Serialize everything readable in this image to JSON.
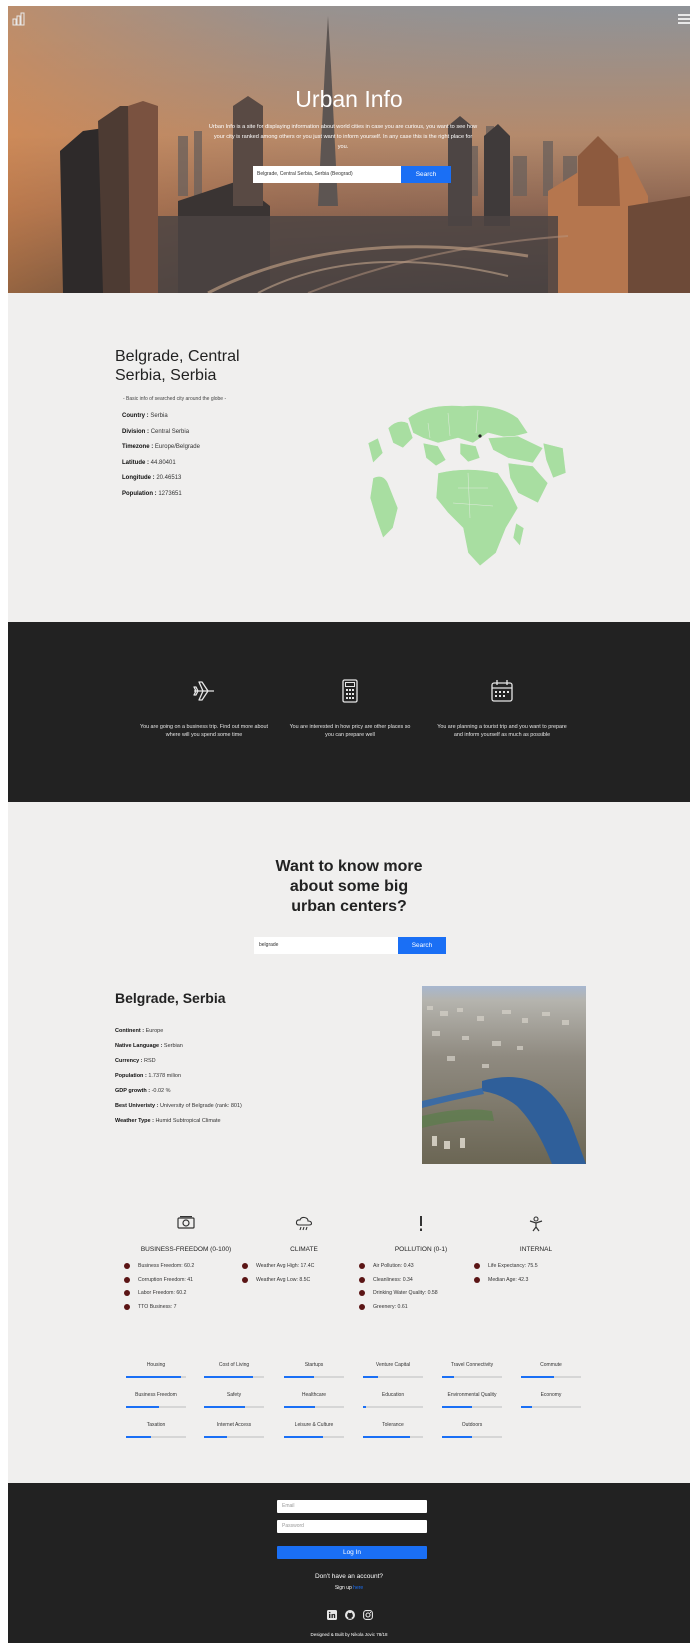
{
  "hero": {
    "title": "Urban Info",
    "tagline": "Urban Info is a site for displaying information about world cities in case you are curious, you want to see how your city is ranked among others or you just want to inform yourself. In any case this is the right place for you.",
    "search_value": "Belgrade, Central Serbia, Serbia (Beograd)",
    "search_button": "Search"
  },
  "city": {
    "title": "Belgrade, Central Serbia, Serbia",
    "subtitle": "- Basic info of searched city around the globe -",
    "fields": [
      {
        "label": "Country :",
        "value": "Serbia"
      },
      {
        "label": "Division :",
        "value": "Central Serbia"
      },
      {
        "label": "Timezone :",
        "value": "Europe/Belgrade"
      },
      {
        "label": "Latitude :",
        "value": "44.80401"
      },
      {
        "label": "Longitude :",
        "value": "20.46513"
      },
      {
        "label": "Population :",
        "value": "1273651"
      }
    ]
  },
  "features": [
    {
      "icon": "airplane-icon",
      "text": "You are going on a business trip. Find out more about where will you spend some time"
    },
    {
      "icon": "calculator-icon",
      "text": "You are interested in how pricy are other places so you can prepare well"
    },
    {
      "icon": "calendar-icon",
      "text": "You are planning a tourist trip and you want to prepare and inform yourself as much as possible"
    }
  ],
  "more": {
    "title": "Want to know more about some big urban centers?",
    "search_value": "belgrade",
    "search_button": "Search"
  },
  "city2": {
    "title": "Belgrade, Serbia",
    "fields": [
      {
        "label": "Continent :",
        "value": "Europe"
      },
      {
        "label": "Native Language :",
        "value": "Serbian"
      },
      {
        "label": "Currency :",
        "value": "RSD"
      },
      {
        "label": "Population :",
        "value": "1.7378 milion"
      },
      {
        "label": "GDP growth :",
        "value": "-0.02 %"
      },
      {
        "label": "Best Univeristy :",
        "value": "University of Belgrade (rank: 801)"
      },
      {
        "label": "Weather Type :",
        "value": "Humid Subtropical Climate"
      }
    ]
  },
  "categories": [
    {
      "icon": "money-icon",
      "title": "BUSINESS-FREEDOM (0-100)",
      "items": [
        "Business Freedom: 60.2",
        "Corruption Freedom: 41",
        "Labor Freedom: 60.2",
        "TTO Business: 7"
      ]
    },
    {
      "icon": "rain-cloud-icon",
      "title": "CLIMATE",
      "items": [
        "Weather Avg High: 17.4C",
        "Weather Avg Low: 8.5C"
      ]
    },
    {
      "icon": "exclamation-icon",
      "title": "POLLUTION (0-1)",
      "items": [
        "Air Pollution: 0.43",
        "Cleanliness: 0.34",
        "Drinking Water Quality: 0.58",
        "Greenery: 0.61"
      ]
    },
    {
      "icon": "person-icon",
      "title": "INTERNAL",
      "items": [
        "Life Expectancy: 75.5",
        "Median Age: 42.3"
      ]
    }
  ],
  "scores": [
    {
      "label": "Housing",
      "value": 0.92
    },
    {
      "label": "Cost of Living",
      "value": 0.82
    },
    {
      "label": "Startups",
      "value": 0.5
    },
    {
      "label": "Venture Capital",
      "value": 0.25
    },
    {
      "label": "Travel Connectivity",
      "value": 0.2
    },
    {
      "label": "Commute",
      "value": 0.55
    },
    {
      "label": "Business Freedom",
      "value": 0.55
    },
    {
      "label": "Safety",
      "value": 0.68
    },
    {
      "label": "Healthcare",
      "value": 0.52
    },
    {
      "label": "Education",
      "value": 0.05
    },
    {
      "label": "Environmental Quality",
      "value": 0.5
    },
    {
      "label": "Economy",
      "value": 0.18
    },
    {
      "label": "Taxation",
      "value": 0.42
    },
    {
      "label": "Internet Access",
      "value": 0.38
    },
    {
      "label": "Leisure & Culture",
      "value": 0.65
    },
    {
      "label": "Tolerance",
      "value": 0.78
    },
    {
      "label": "Outdoors",
      "value": 0.5
    }
  ],
  "footer": {
    "email_placeholder": "Email",
    "password_placeholder": "Password",
    "login_button": "Log In",
    "no_account": "Don't have an account?",
    "signup_text": "Sign up",
    "signup_link": "here",
    "credit": "Designed & Built by Nikola Jovic 78/18"
  },
  "colors": {
    "accent": "#1a6ff5",
    "dark": "#222222",
    "light_bg": "#f0efee",
    "bullet": "#5b1515",
    "globe": "#a8dea1"
  }
}
